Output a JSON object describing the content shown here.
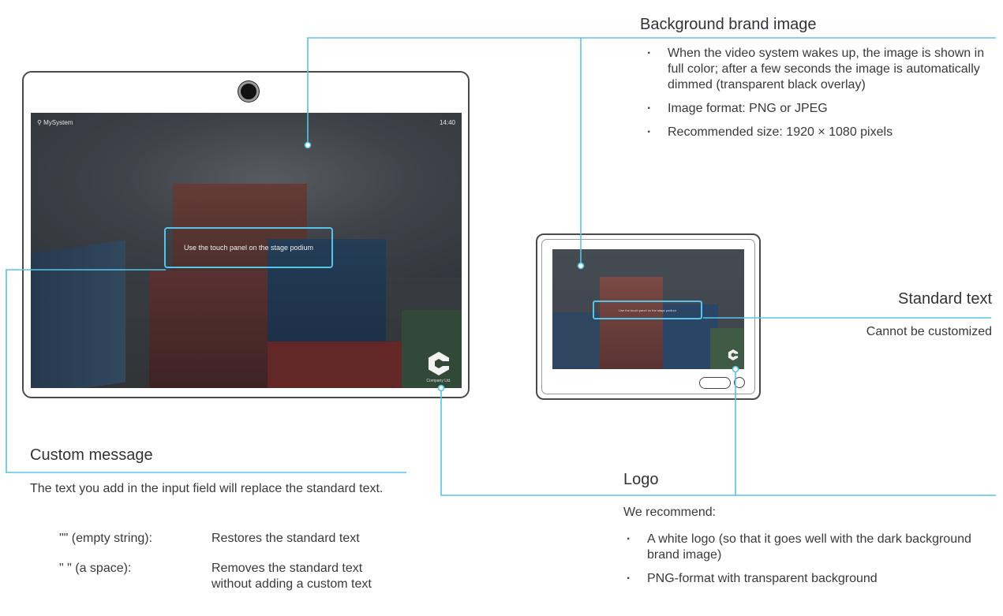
{
  "main_display": {
    "system_name": "MySystem",
    "clock": "14:40",
    "message": "Use the touch panel on the stage podium",
    "logo_caption": "Company Ltd."
  },
  "touch_panel": {
    "message": "Use the touch panel on the stage podium"
  },
  "background": {
    "title": "Background brand image",
    "bullets": [
      "When the video system wakes up, the image is shown in full color; after a few seconds the image is automatically dimmed (transparent black overlay)",
      "Image format: PNG or JPEG",
      "Recommended size: 1920 × 1080 pixels"
    ]
  },
  "standard": {
    "title": "Standard text",
    "desc": "Cannot be customized"
  },
  "custom": {
    "title": "Custom message",
    "desc": "The text you add in the input field will replace the standard text.",
    "options": [
      {
        "key": "\"\" (empty string):",
        "value": "Restores the standard text"
      },
      {
        "key": "\" \" (a space):",
        "value": "Removes the standard text without adding a custom text"
      }
    ]
  },
  "logo": {
    "title": "Logo",
    "desc": "We recommend:",
    "bullets": [
      "A white logo (so that it goes well with the dark background brand image)",
      "PNG-format with transparent background"
    ]
  },
  "colors": {
    "callout": "#57c3e8",
    "frame": "#4a4a4a"
  }
}
